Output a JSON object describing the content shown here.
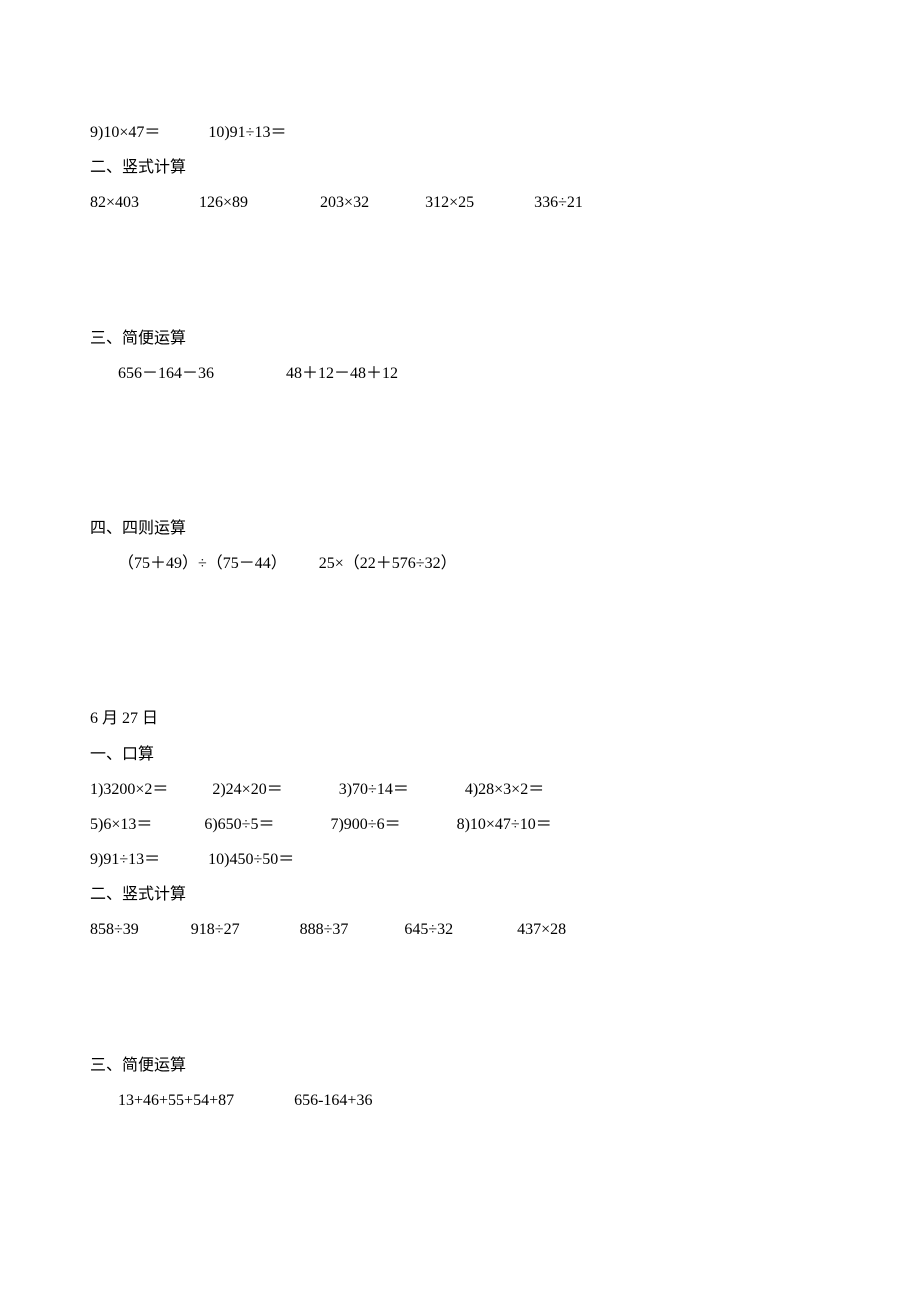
{
  "section1_mental": {
    "row": "9)10×47＝            10)91÷13＝"
  },
  "section2_header": "二、竖式计算",
  "section2_row": "82×403               126×89                  203×32              312×25               336÷21",
  "section3_header": "三、简便运算",
  "section3_row": "656－164－36                  48＋12－48＋12",
  "section4_header": "四、四则运算",
  "section4_row": "（75＋49）÷（75－44）        25×（22＋576÷32）",
  "date_header": "6 月 27 日",
  "bsection1_header": "一、口算",
  "bsection1_row1": "1)3200×2＝           2)24×20＝              3)70÷14＝              4)28×3×2＝",
  "bsection1_row2": "5)6×13＝             6)650÷5＝              7)900÷6＝              8)10×47÷10＝",
  "bsection1_row3": "9)91÷13＝            10)450÷50＝",
  "bsection2_header": "二、竖式计算",
  "bsection2_row": "858÷39             918÷27               888÷37              645÷32                437×28",
  "bsection3_header": "三、简便运算",
  "bsection3_row": "13+46+55+54+87               656-164+36"
}
